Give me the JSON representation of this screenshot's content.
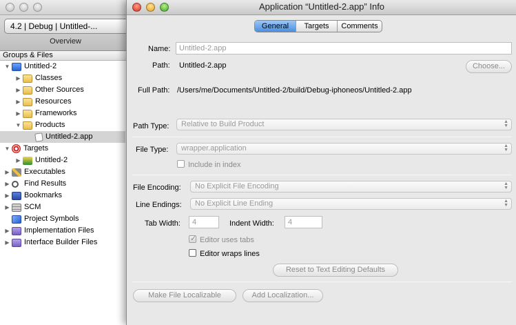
{
  "project_window": {
    "project_popup": "4.2 | Debug | Untitled-...",
    "overview_label": "Overview",
    "groups_header": "Groups & Files",
    "tree": [
      {
        "label": "Untitled-2",
        "icon": "project-icon"
      },
      {
        "label": "Classes",
        "icon": "folder-icon"
      },
      {
        "label": "Other Sources",
        "icon": "folder-icon"
      },
      {
        "label": "Resources",
        "icon": "folder-icon"
      },
      {
        "label": "Frameworks",
        "icon": "folder-icon"
      },
      {
        "label": "Products",
        "icon": "folder-icon"
      },
      {
        "label": "Untitled-2.app",
        "icon": "app-file-icon"
      },
      {
        "label": "Targets",
        "icon": "target-icon"
      },
      {
        "label": "Untitled-2",
        "icon": "target-app-icon"
      },
      {
        "label": "Executables",
        "icon": "executable-icon"
      },
      {
        "label": "Find Results",
        "icon": "magnifier-icon"
      },
      {
        "label": "Bookmarks",
        "icon": "bookmark-icon"
      },
      {
        "label": "SCM",
        "icon": "scm-icon"
      },
      {
        "label": "Project Symbols",
        "icon": "symbols-cube-icon"
      },
      {
        "label": "Implementation Files",
        "icon": "smart-group-icon"
      },
      {
        "label": "Interface Builder Files",
        "icon": "smart-group-icon"
      }
    ]
  },
  "info_window": {
    "title": "Application “Untitled-2.app” Info",
    "tabs": [
      "General",
      "Targets",
      "Comments"
    ],
    "active_tab": "General",
    "name_label": "Name:",
    "name_value": "Untitled-2.app",
    "path_label": "Path:",
    "path_value": "Untitled-2.app",
    "choose_button": "Choose...",
    "full_path_label": "Full Path:",
    "full_path_value": "/Users/me/Documents/Untitled-2/build/Debug-iphoneos/Untitled-2.app",
    "path_type_label": "Path Type:",
    "path_type_value": "Relative to Build Product",
    "file_type_label": "File Type:",
    "file_type_value": "wrapper.application",
    "include_in_index": "Include in index",
    "file_encoding_label": "File Encoding:",
    "file_encoding_value": "No Explicit File Encoding",
    "line_endings_label": "Line Endings:",
    "line_endings_value": "No Explicit Line Ending",
    "tab_width_label": "Tab Width:",
    "tab_width_value": "4",
    "indent_width_label": "Indent Width:",
    "indent_width_value": "4",
    "editor_uses_tabs": "Editor uses tabs",
    "editor_wraps_lines": "Editor wraps lines",
    "reset_button": "Reset to Text Editing Defaults",
    "make_localizable_button": "Make File Localizable",
    "add_localization_button": "Add Localization..."
  }
}
